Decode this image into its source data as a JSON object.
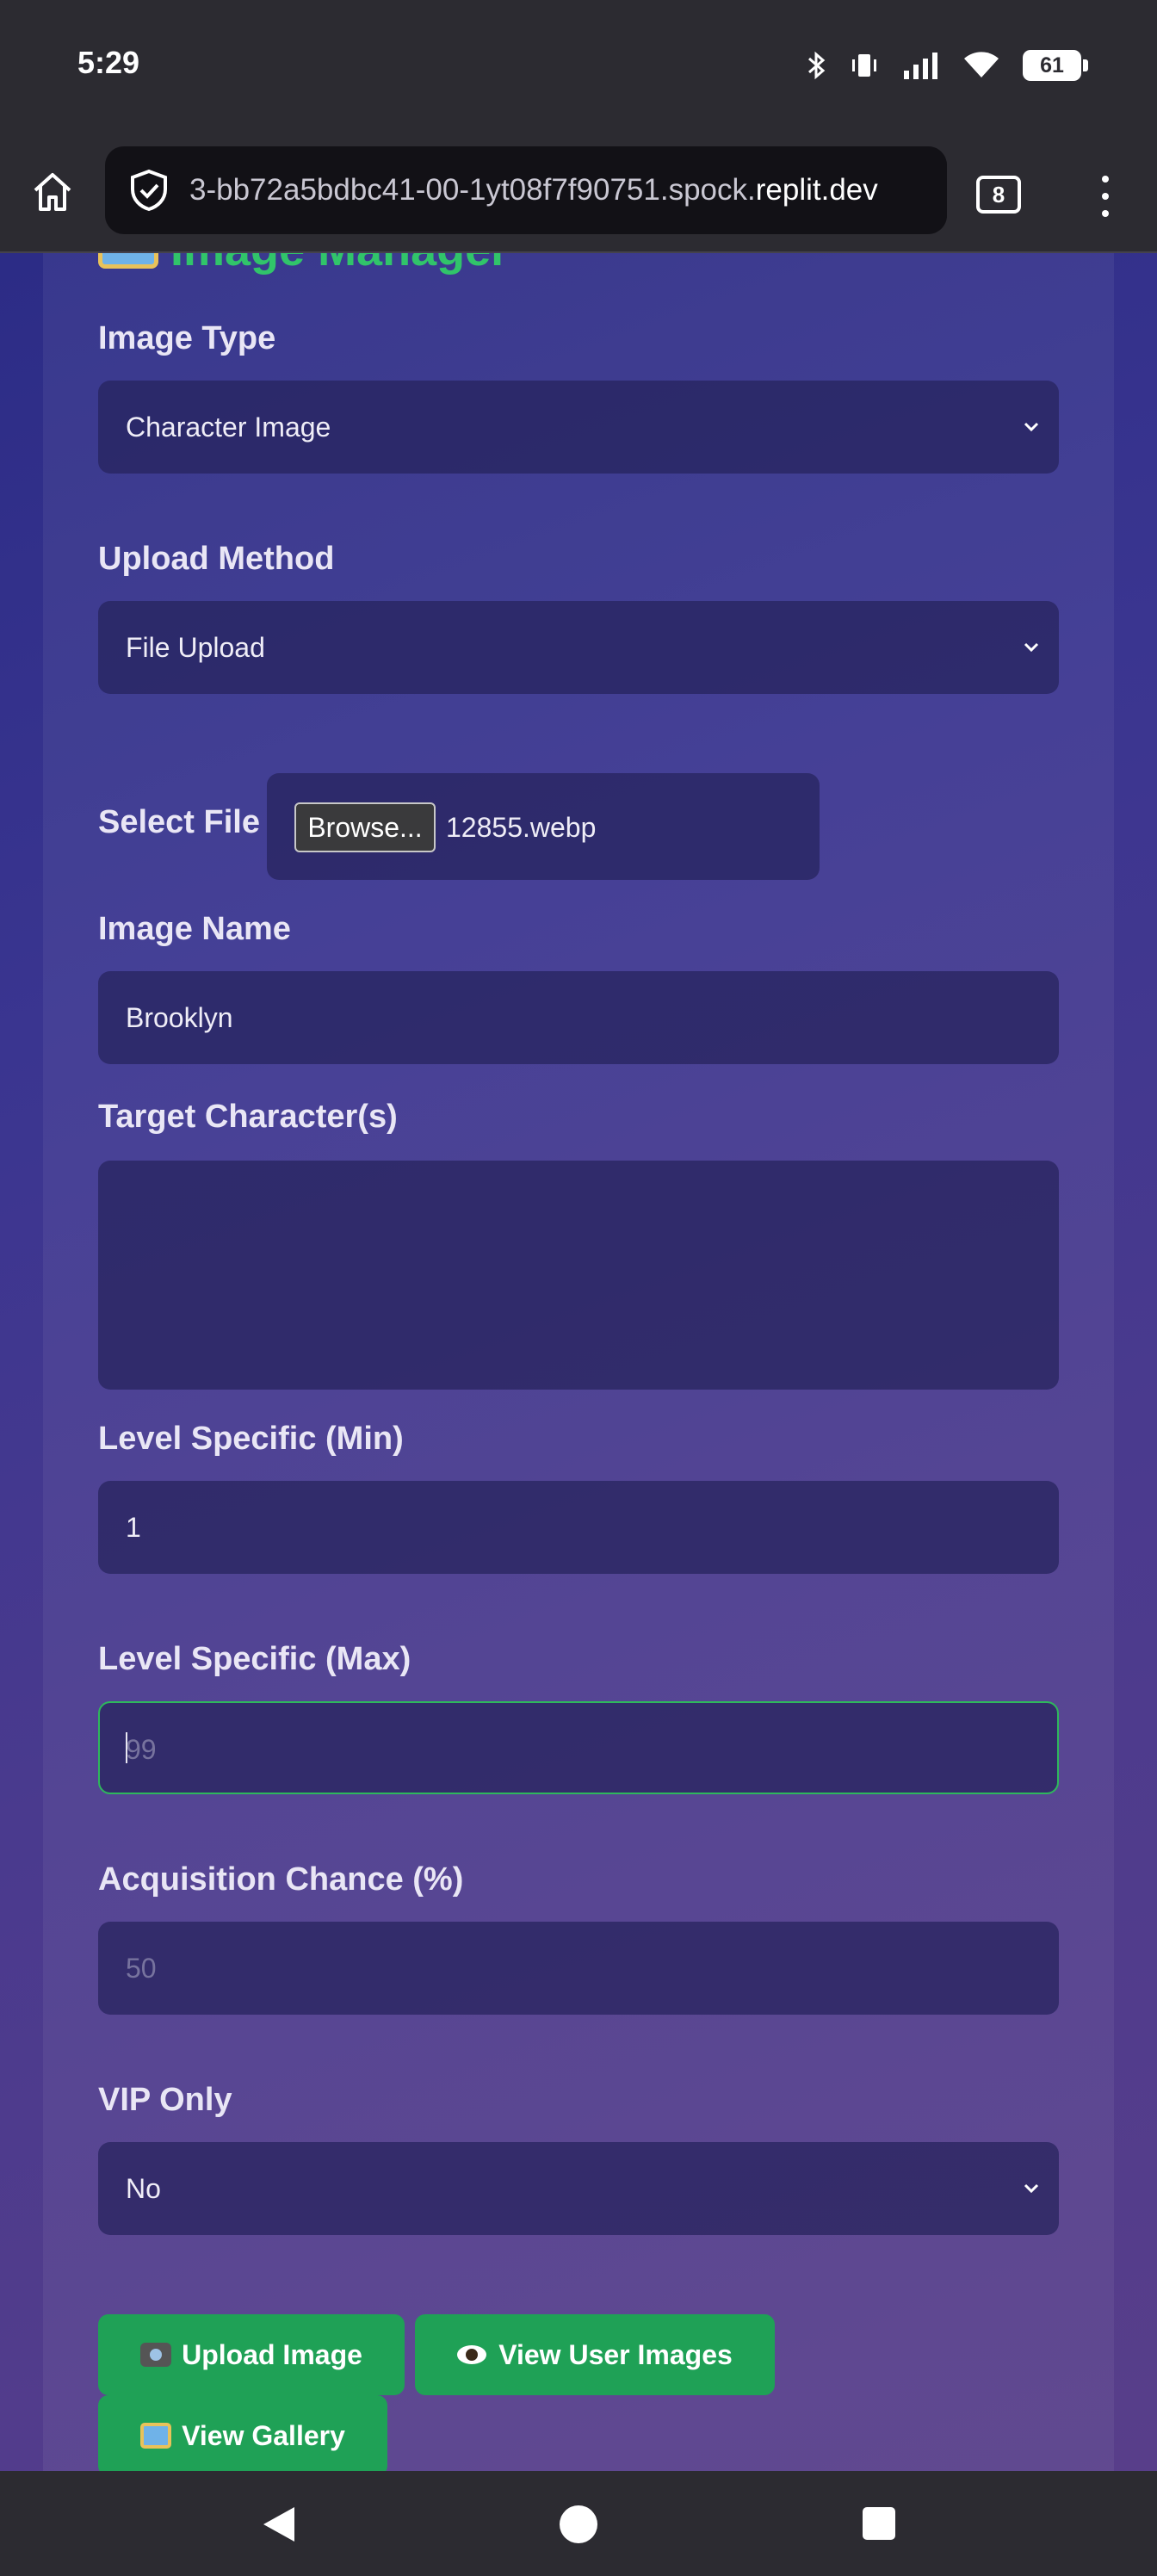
{
  "status_bar": {
    "time": "5:29",
    "battery": "61"
  },
  "browser": {
    "url_prefix": "3-bb72a5bdbc41-00-1yt08f7f90751.spock.",
    "url_domain": "replit.dev",
    "tab_count": "8"
  },
  "page": {
    "heading": "Image Manager"
  },
  "form": {
    "image_type": {
      "label": "Image Type",
      "value": "Character Image"
    },
    "upload_method": {
      "label": "Upload Method",
      "value": "File Upload"
    },
    "select_file": {
      "label": "Select File",
      "button": "Browse...",
      "file_name": "12855.webp"
    },
    "image_name": {
      "label": "Image Name",
      "value": "Brooklyn"
    },
    "target_characters": {
      "label": "Target Character(s)",
      "value": ""
    },
    "level_min": {
      "label": "Level Specific (Min)",
      "value": "1"
    },
    "level_max": {
      "label": "Level Specific (Max)",
      "placeholder": "99"
    },
    "acquisition_chance": {
      "label": "Acquisition Chance (%)",
      "placeholder": "50"
    },
    "vip_only": {
      "label": "VIP Only",
      "value": "No"
    }
  },
  "actions": {
    "upload_image": "Upload Image",
    "view_user_images": "View User Images",
    "view_gallery": "View Gallery"
  },
  "colors": {
    "heading": "#31c46a",
    "button": "#1fa156",
    "focus_border": "#2eb85c"
  }
}
